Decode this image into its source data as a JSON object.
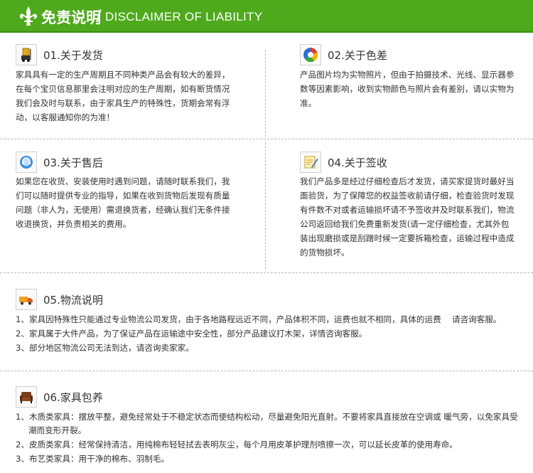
{
  "banner": {
    "title_zh": "免责说明",
    "slash": "/",
    "title_en": "DISCLAIMER OF LIABILITY",
    "color": "#4fa91c"
  },
  "sections": {
    "delivery": {
      "title": "01.关于发货",
      "icon": "forklift-icon",
      "lines": [
        "家具具有一定的生产周期且不同种类产品会有较大的差异，",
        "在每个宝贝信息那里会注明对应的生产周期，如有断货情况",
        "我们会及时与联系，由于家具生产的特殊性，货期会常有浮",
        "动，以客服通知你的为准！"
      ]
    },
    "color_diff": {
      "title": "02.关于色差",
      "icon": "color-wheel-icon",
      "lines": [
        "产品图片均为实物照片，但由于拍摄技术、光线、显示器参",
        "数等因素影响，收到实物颜色与照片会有差别，请以实物为",
        "准。"
      ]
    },
    "after_sales": {
      "title": "03.关于售后",
      "icon": "support-icon",
      "lines": [
        "如果您在收货、安装使用时遇到问题，请随时联系我们，我",
        "们可以随时提供专业的指导，如果在收到货物后发现有质量",
        "问题（非人为，无使用）需退换货者，经确认我们无条件接",
        "收退换货，并负责相关的费用。"
      ]
    },
    "signing": {
      "title": "04.关于签收",
      "icon": "sign-note-icon",
      "lines": [
        "我们产品多是经过仔细检查后才发货，请买家提货时最好当",
        "面验货，为了保障您的权益签收前请仔细，检查验货时发现",
        "有件数不对或者运输损坏请不予签收并及时联系我们，物流",
        "公司返回给我们免费重新发货(请一定仔细检查，尤其外包",
        "装出现磨损或是刮蹭时候一定要拆箱检查，运输过程中造成",
        "的货物损坏。"
      ]
    },
    "logistics": {
      "title": "05.物流说明",
      "icon": "truck-icon",
      "items": [
        "1、家具因特殊性只能通过专业物流公司发货，由于各地路程远近不同，产品体积不同，运费也就不相同，具体的运费　  请咨询客服。",
        "2、家具属于大件产品，为了保证产品在运输途中安全性，部分产品建议打木架，详情咨询客服。",
        "3、部分地区物流公司无法到达，请咨询卖家家。"
      ]
    },
    "maintenance": {
      "title": "06.家具包养",
      "icon": "armchair-icon",
      "items": [
        "1、木质类家具：摆放平整，避免经常处于不稳定状态而使结构松动，尽量避免阳光直射。不要将家具直接放在空调或 暖气旁，以免家具受",
        "潮而变形开裂。",
        "2、皮质类家具：经常保持清洁，用纯棉布轻轻拭去表明灰尘，每个月用皮革护理剂喷擦一次，可以延长皮革的使用寿命。",
        "3、布艺类家具：用干净的棉布、羽制毛。"
      ]
    }
  }
}
